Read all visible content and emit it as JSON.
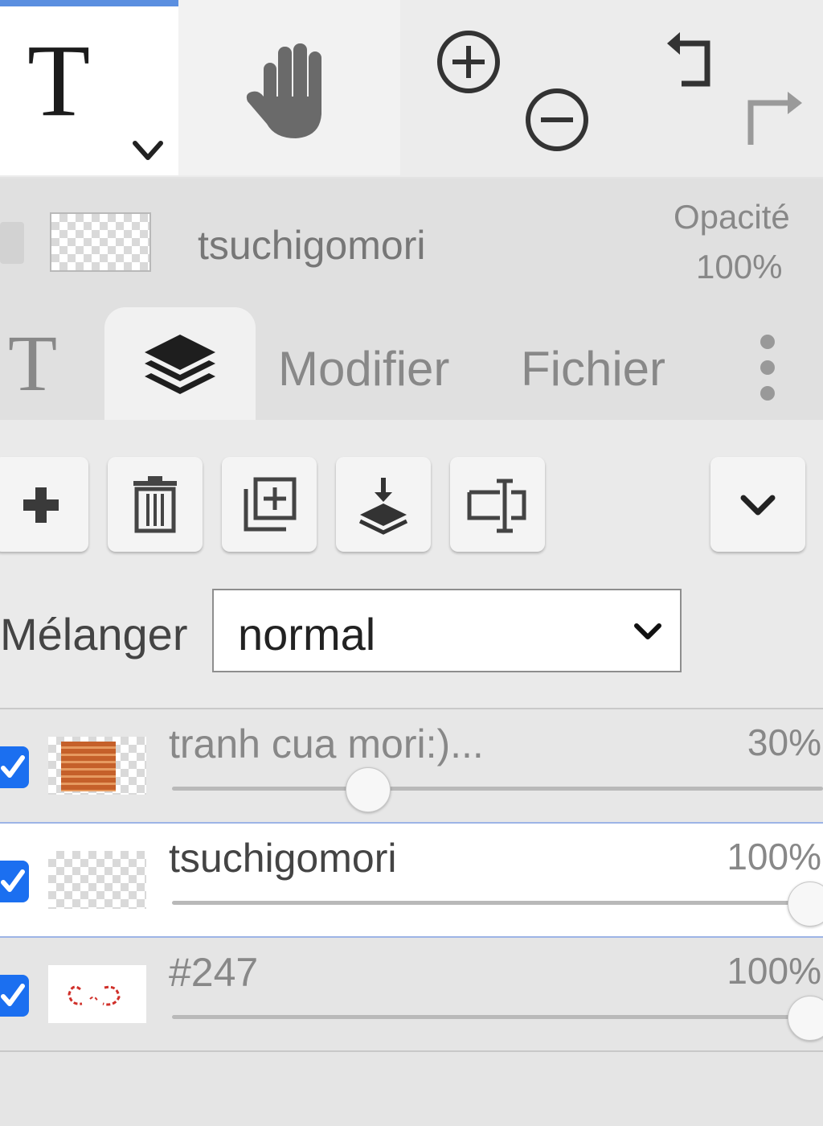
{
  "toolbar": {
    "tools": [
      {
        "name": "text-tool",
        "glyph": "T"
      },
      {
        "name": "hand-tool"
      }
    ],
    "actions": [
      "zoom-in",
      "zoom-out",
      "undo",
      "redo"
    ]
  },
  "layer_header": {
    "name": "tsuchigomori",
    "opacity_label": "Opacité",
    "opacity_value": "100%"
  },
  "tabs": {
    "text_glyph": "T",
    "modifier": "Modifier",
    "file": "Fichier"
  },
  "layer_actions": [
    "add-layer",
    "delete-layer",
    "duplicate-layer",
    "merge-down",
    "rename-layer",
    "more-options"
  ],
  "blend": {
    "label": "Mélanger",
    "value": "normal"
  },
  "layers": [
    {
      "name": "tranh cua mori:)...",
      "opacity": "30%",
      "opacity_fraction": 0.3,
      "visible": true,
      "selected": false
    },
    {
      "name": "tsuchigomori",
      "opacity": "100%",
      "opacity_fraction": 1.0,
      "visible": true,
      "selected": true
    },
    {
      "name": "#247",
      "opacity": "100%",
      "opacity_fraction": 1.0,
      "visible": true,
      "selected": false
    }
  ],
  "colors": {
    "accent": "#1b6ff0",
    "selection_border": "#9db4e6"
  }
}
